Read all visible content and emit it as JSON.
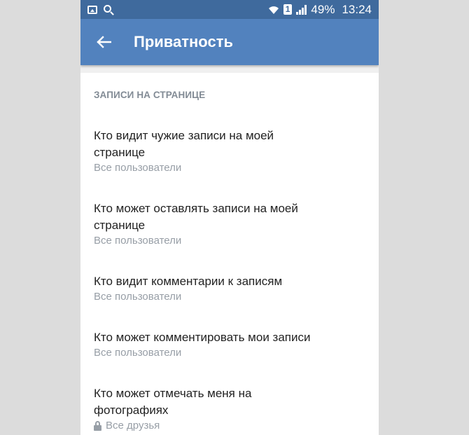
{
  "status_bar": {
    "battery": "49%",
    "time": "13:24",
    "sim": "1",
    "icons": [
      "gallery-icon",
      "search-icon",
      "wifi-icon",
      "sim-icon",
      "signal-icon"
    ]
  },
  "header": {
    "title": "Приватность",
    "back_icon": "arrow-left-icon"
  },
  "section": {
    "title": "ЗАПИСИ НА СТРАНИЦЕ"
  },
  "items": [
    {
      "title_line1": "Кто видит чужие записи на моей",
      "title_line2": "странице",
      "value": "Все пользователи"
    },
    {
      "title_line1": "Кто может оставлять записи на моей",
      "title_line2": "странице",
      "value": "Все пользователи"
    },
    {
      "title_line1": "Кто видит комментарии к записям",
      "title_line2": "",
      "value": "Все пользователи"
    },
    {
      "title_line1": "Кто может комментировать мои записи",
      "title_line2": "",
      "value": "Все пользователи"
    },
    {
      "title_line1": "Кто может отмечать меня на",
      "title_line2": "фотографиях",
      "value": "Все друзья",
      "value_icon": "lock-icon"
    }
  ],
  "colors": {
    "status_bar": "#3f6a9d",
    "app_bar": "#5282be",
    "section_header": "#828b95",
    "secondary_text": "#979ea6"
  }
}
